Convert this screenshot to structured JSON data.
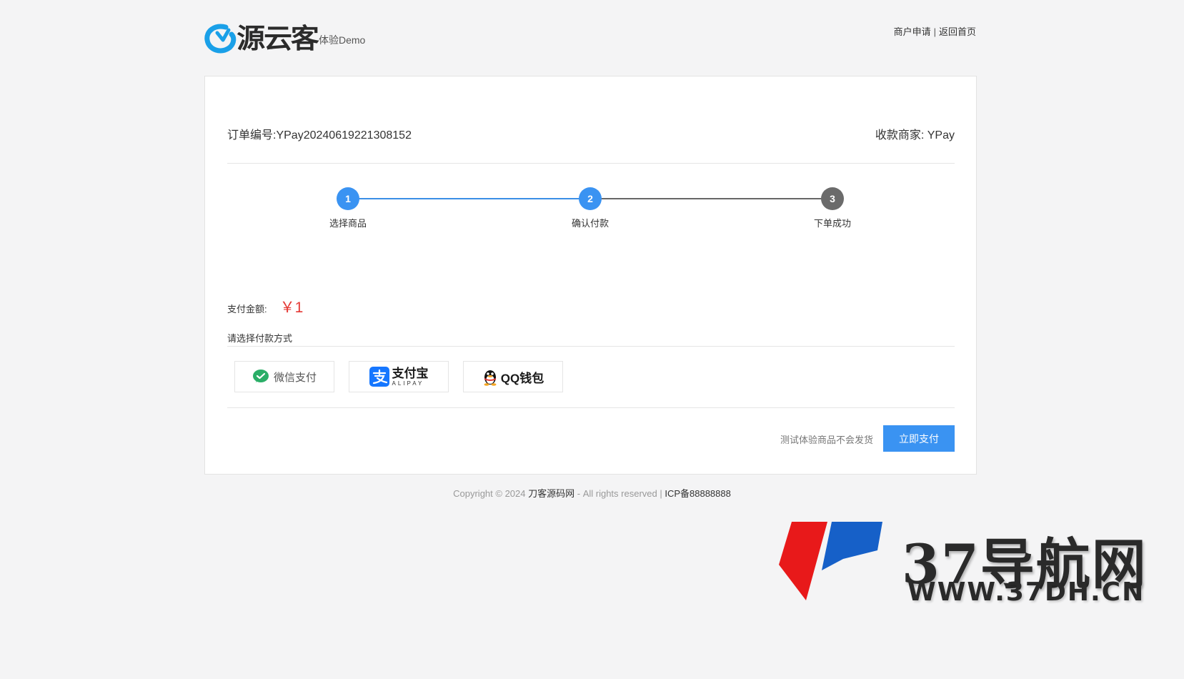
{
  "header": {
    "logo_text": "源云客",
    "demo_label": "体验Demo",
    "links": [
      "商户申请",
      "返回首页"
    ],
    "separator": "|"
  },
  "order": {
    "number_label": "订单编号:",
    "number": "YPay20240619221308152",
    "merchant_label": "收款商家:",
    "merchant": "YPay"
  },
  "steps": [
    {
      "num": "1",
      "label": "选择商品"
    },
    {
      "num": "2",
      "label": "确认付款"
    },
    {
      "num": "3",
      "label": "下单成功"
    }
  ],
  "payment": {
    "amount_label": "支付金额:",
    "amount": "￥1",
    "choose_label": "请选择付款方式",
    "methods": {
      "wechat": "微信支付",
      "alipay_cn": "支付宝",
      "alipay_en": "ALIPAY",
      "qq": "QQ钱包"
    },
    "notice": "测试体验商品不会发货",
    "pay_button": "立即支付"
  },
  "footer": {
    "copyright": "Copyright © 2024",
    "brand": "刀客源码网",
    "rights": "- All rights reserved |",
    "icp": "ICP备88888888"
  },
  "watermark": {
    "line1": "37导航网",
    "line2": "WWW.37DH.CN"
  },
  "colors": {
    "primary": "#3a93f2",
    "amount": "#e53935",
    "step_done": "#6b6b6b",
    "wechat_green": "#2aae67",
    "alipay_blue": "#1677ff"
  }
}
